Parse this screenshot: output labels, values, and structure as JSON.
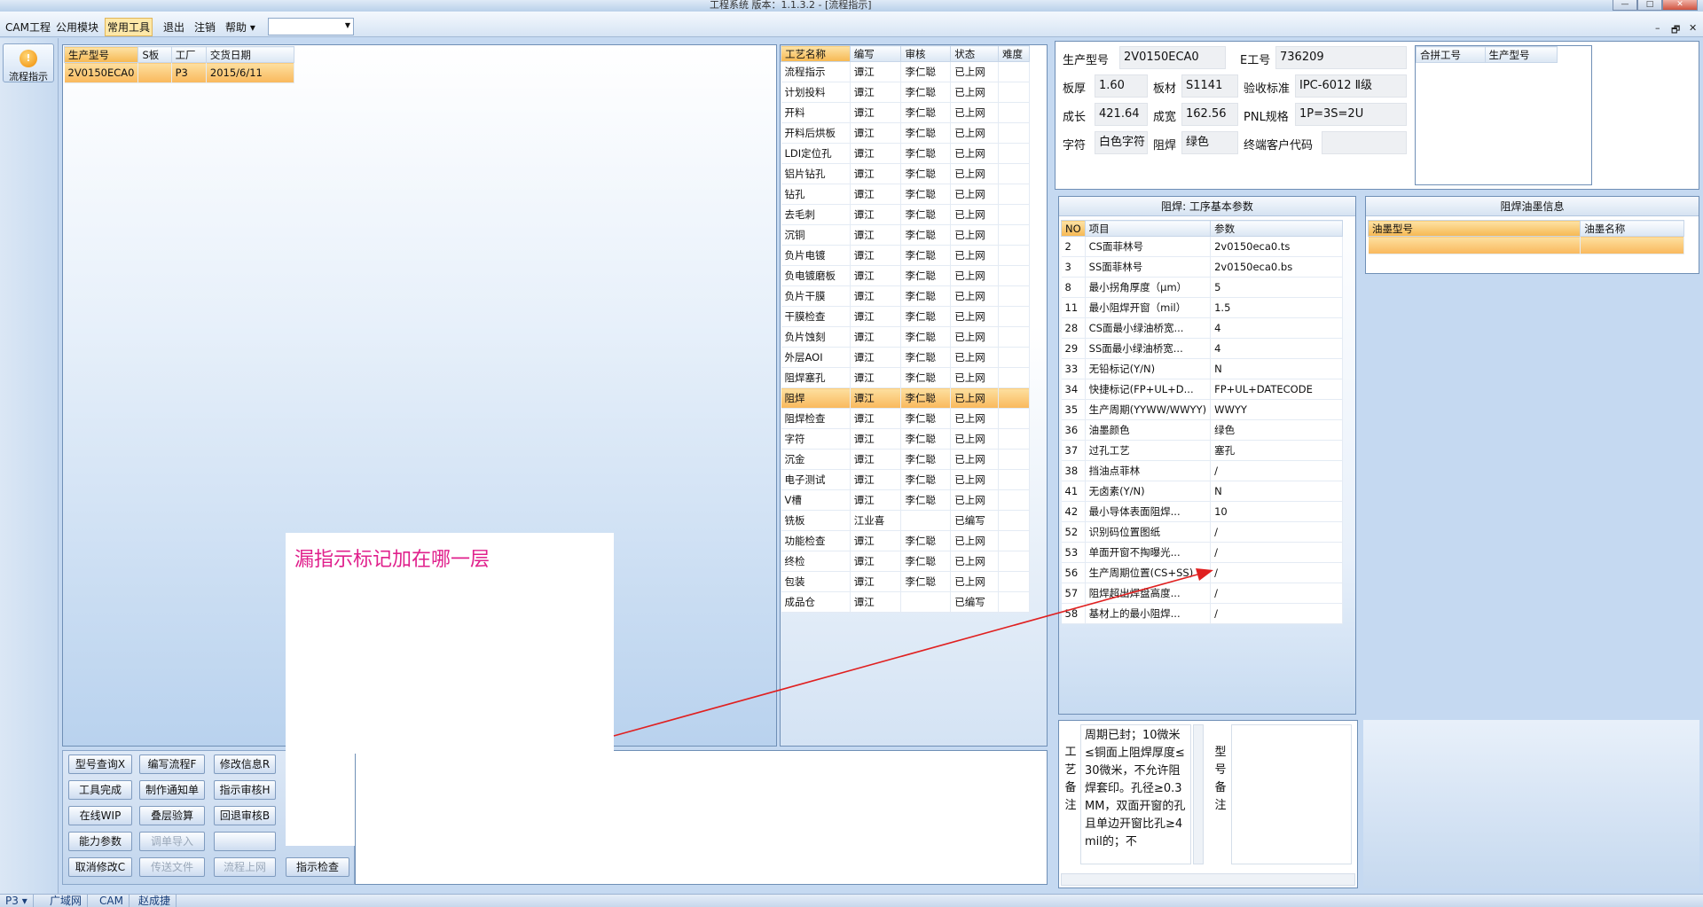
{
  "window": {
    "title": "工程系统   版本：1.1.3.2 - [流程指示]",
    "min": "—",
    "max": "□",
    "close": "✕"
  },
  "menus": [
    "CAM工程",
    "公用模块",
    "常用工具",
    "退出",
    "注销",
    "帮助 ▾"
  ],
  "menu_selected": 2,
  "mdi_controls": [
    "–",
    "🗗",
    "✕"
  ],
  "nav": {
    "label": "流程指示"
  },
  "order_grid": {
    "headers": [
      "生产型号",
      "S板",
      "工厂",
      "交货日期"
    ],
    "rows": [
      [
        "2V0150ECA0",
        "",
        "P3",
        "2015/6/11"
      ]
    ]
  },
  "process_grid": {
    "headers": [
      "工艺名称",
      "编写",
      "审核",
      "状态",
      "难度"
    ],
    "rows": [
      [
        "流程指示",
        "谭江",
        "李仁聪",
        "已上网",
        ""
      ],
      [
        "计划投料",
        "谭江",
        "李仁聪",
        "已上网",
        ""
      ],
      [
        "开料",
        "谭江",
        "李仁聪",
        "已上网",
        ""
      ],
      [
        "开料后烘板",
        "谭江",
        "李仁聪",
        "已上网",
        ""
      ],
      [
        "LDI定位孔",
        "谭江",
        "李仁聪",
        "已上网",
        ""
      ],
      [
        "铝片钻孔",
        "谭江",
        "李仁聪",
        "已上网",
        ""
      ],
      [
        "钻孔",
        "谭江",
        "李仁聪",
        "已上网",
        ""
      ],
      [
        "去毛刺",
        "谭江",
        "李仁聪",
        "已上网",
        ""
      ],
      [
        "沉铜",
        "谭江",
        "李仁聪",
        "已上网",
        ""
      ],
      [
        "负片电镀",
        "谭江",
        "李仁聪",
        "已上网",
        ""
      ],
      [
        "负电镀磨板",
        "谭江",
        "李仁聪",
        "已上网",
        ""
      ],
      [
        "负片干膜",
        "谭江",
        "李仁聪",
        "已上网",
        ""
      ],
      [
        "干膜检查",
        "谭江",
        "李仁聪",
        "已上网",
        ""
      ],
      [
        "负片蚀刻",
        "谭江",
        "李仁聪",
        "已上网",
        ""
      ],
      [
        "外层AOI",
        "谭江",
        "李仁聪",
        "已上网",
        ""
      ],
      [
        "阻焊塞孔",
        "谭江",
        "李仁聪",
        "已上网",
        ""
      ],
      [
        "阻焊",
        "谭江",
        "李仁聪",
        "已上网",
        ""
      ],
      [
        "阻焊检查",
        "谭江",
        "李仁聪",
        "已上网",
        ""
      ],
      [
        "字符",
        "谭江",
        "李仁聪",
        "已上网",
        ""
      ],
      [
        "沉金",
        "谭江",
        "李仁聪",
        "已上网",
        ""
      ],
      [
        "电子测试",
        "谭江",
        "李仁聪",
        "已上网",
        ""
      ],
      [
        "V槽",
        "谭江",
        "李仁聪",
        "已上网",
        ""
      ],
      [
        "铣板",
        "江业喜",
        "",
        "已编写",
        ""
      ],
      [
        "功能检查",
        "谭江",
        "李仁聪",
        "已上网",
        ""
      ],
      [
        "终检",
        "谭江",
        "李仁聪",
        "已上网",
        ""
      ],
      [
        "包装",
        "谭江",
        "李仁聪",
        "已上网",
        ""
      ],
      [
        "成品仓",
        "谭江",
        "",
        "已编写",
        ""
      ]
    ],
    "selected": 16
  },
  "info": {
    "prod_model_lbl": "生产型号",
    "prod_model": "2V0150ECA0",
    "eno_lbl": "E工号",
    "eno": "736209",
    "thick_lbl": "板厚",
    "thick": "1.60",
    "material_lbl": "板材",
    "material": "S1141",
    "std_lbl": "验收标准",
    "std": "IPC-6012 Ⅱ级",
    "len_lbl": "成长",
    "len": "421.64",
    "wid_lbl": "成宽",
    "wid": "162.56",
    "pnl_lbl": "PNL规格",
    "pnl": "1P=3S=2U",
    "char_lbl": "字符",
    "char": "白色字符",
    "mask_lbl": "阻焊",
    "mask": "绿色",
    "cust_lbl": "终端客户代码",
    "cust": ""
  },
  "merge_grid": {
    "headers": [
      "合拼工号",
      "生产型号"
    ]
  },
  "params": {
    "title": "阻焊: 工序基本参数",
    "headers": [
      "NO",
      "项目",
      "参数"
    ],
    "rows": [
      [
        "2",
        "CS面菲林号",
        "2v0150eca0.ts"
      ],
      [
        "3",
        "SS面菲林号",
        "2v0150eca0.bs"
      ],
      [
        "8",
        "最小拐角厚度（μm）",
        "5"
      ],
      [
        "11",
        "最小阻焊开窗（mil）",
        "1.5"
      ],
      [
        "28",
        "CS面最小绿油桥宽...",
        "4"
      ],
      [
        "29",
        "SS面最小绿油桥宽...",
        "4"
      ],
      [
        "33",
        "无铅标记(Y/N)",
        "N"
      ],
      [
        "34",
        "快捷标记(FP+UL+D...",
        "FP+UL+DATECODE"
      ],
      [
        "35",
        "生产周期(YYWW/WWYY)",
        "WWYY"
      ],
      [
        "36",
        "油墨颜色",
        "绿色"
      ],
      [
        "37",
        "过孔工艺",
        "塞孔"
      ],
      [
        "38",
        "挡油点菲林",
        "/"
      ],
      [
        "41",
        "无卤素(Y/N)",
        "N"
      ],
      [
        "42",
        "最小导体表面阻焊...",
        "10"
      ],
      [
        "52",
        "识别码位置图纸",
        "/"
      ],
      [
        "53",
        "单面开窗不掏曝光...",
        "/"
      ],
      [
        "56",
        "生产周期位置(CS+SS)",
        "/"
      ],
      [
        "57",
        "阻焊超出焊盘高度...",
        "/"
      ],
      [
        "58",
        "基材上的最小阻焊...",
        "/"
      ]
    ]
  },
  "ink": {
    "title": "阻焊油墨信息",
    "headers": [
      "油墨型号",
      "油墨名称"
    ]
  },
  "remarks": {
    "craft_label": "工艺备注",
    "craft_text": "周期已封；10微米≤铜面上阻焊厚度≤30微米，不允许阻焊套印。孔径≥0.3MM，双面开窗的孔且单边开窗比孔≥4mil的；不",
    "model_label": "型号备注"
  },
  "buttons": [
    [
      "型号查询X",
      "编写流程F",
      "修改信息R",
      ""
    ],
    [
      "工具完成",
      "制作通知单",
      "指示审核H",
      ""
    ],
    [
      "在线WIP",
      "叠层验算",
      "回退审核B",
      ""
    ],
    [
      "能力参数",
      "调单导入",
      "",
      ""
    ],
    [
      "取消修改C",
      "传送文件",
      "流程上网",
      "指示检查"
    ]
  ],
  "annotation": {
    "text": "漏指示标记加在哪一层",
    "color": "#e0208c",
    "arrow_color": "#e02020"
  },
  "status": [
    "P3",
    "广域网",
    "CAM",
    "赵成捷"
  ]
}
